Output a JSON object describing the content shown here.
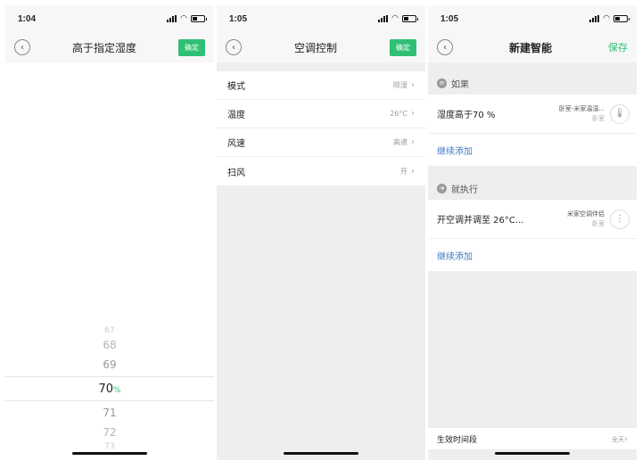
{
  "panel1": {
    "status_time": "1:04",
    "nav_title": "高于指定湿度",
    "confirm_label": "确定",
    "picker": {
      "faint_top": "67",
      "items_above": [
        "68",
        "69"
      ],
      "selected_value": "70",
      "selected_unit": "%",
      "items_below": [
        "71",
        "72"
      ],
      "faint_bottom": "73"
    }
  },
  "panel2": {
    "status_time": "1:05",
    "nav_title": "空调控制",
    "confirm_label": "确定",
    "settings": [
      {
        "label": "模式",
        "value": "除湿"
      },
      {
        "label": "温度",
        "value": "26°C"
      },
      {
        "label": "风速",
        "value": "高速"
      },
      {
        "label": "扫风",
        "value": "开"
      }
    ]
  },
  "panel3": {
    "status_time": "1:05",
    "nav_title": "新建智能",
    "save_label": "保存",
    "if_label": "如果",
    "condition": {
      "text": "湿度高于70 %",
      "device": "卧室-米家温湿...",
      "room": "卧室"
    },
    "add_more_1": "继续添加",
    "then_label": "就执行",
    "action": {
      "text": "开空调并调至 26°C...",
      "device": "米家空调伴侣",
      "room": "卧室"
    },
    "add_more_2": "继续添加",
    "effective_period_label": "生效时间段",
    "effective_period_value": "全天"
  },
  "icons": {
    "back": "back-icon",
    "chevron": "chevron-right-icon",
    "if": "if-icon",
    "then": "then-icon",
    "thermometer": "thermometer-icon",
    "ac": "ac-icon"
  },
  "colors": {
    "accent_green": "#2fbf75",
    "link_blue": "#3b78c3"
  }
}
